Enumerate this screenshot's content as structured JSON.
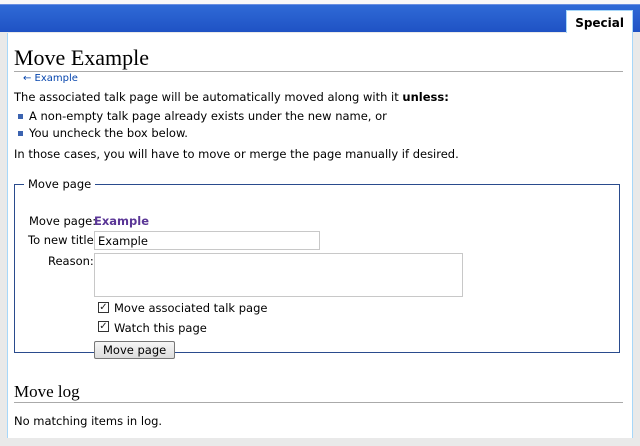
{
  "tabs": {
    "special": "Special"
  },
  "page": {
    "title": "Move Example",
    "backlink": "← Example",
    "intro_text": "The associated talk page will be automatically moved along with it ",
    "intro_bold": "unless:",
    "cases": [
      "A non-empty talk page already exists under the new name, or",
      "You uncheck the box below."
    ],
    "outro": "In those cases, you will have to move or merge the page manually if desired."
  },
  "form": {
    "legend": "Move page",
    "move_page_label": "Move page:",
    "move_page_target": "Example",
    "new_title_label": "To new title:",
    "new_title_value": "Example",
    "reason_label": "Reason:",
    "reason_value": "",
    "checkboxes": [
      {
        "label": "Move associated talk page",
        "checked": true
      },
      {
        "label": "Watch this page",
        "checked": true
      }
    ],
    "submit_label": "Move page"
  },
  "log": {
    "heading": "Move log",
    "empty_text": "No matching items in log."
  },
  "colors": {
    "header_blue": "#1f52c4",
    "link": "#0645ad",
    "visited_link": "#5a3696",
    "fieldset_border": "#2a4b8d"
  }
}
